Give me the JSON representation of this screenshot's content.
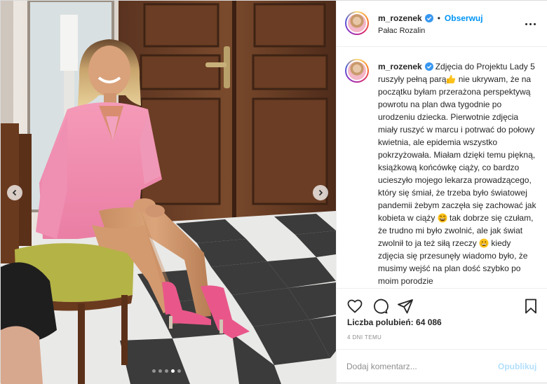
{
  "post": {
    "username": "m_rozenek",
    "follow_label": "Obserwuj",
    "location": "Pałac Rozalin",
    "caption_text": "Zdjęcia do Projektu Lady 5 ruszyły pełną parą",
    "caption_text_2": " nie ukrywam, że na początku byłam przerażona perspektywą powrotu na plan dwa tygodnie po urodzeniu dziecka. Pierwotnie zdjęcia miały ruszyć w marcu i potrwać do połowy kwietnia, ale epidemia wszystko pokrzyżowała. Miałam dzięki temu piękną, książkową końcówkę ciąży, co bardzo ucieszyło mojego lekarza prowadzącego, który się śmiał, że trzeba było światowej pandemii żebym zaczęła się zachować jak kobieta w ciąży",
    "caption_text_3": " tak dobrze się czułam, że trudno mi było zwolnić, ale jak świat zwolnił to ja też siłą rzeczy",
    "caption_text_4": " kiedy zdjęcia się przesunęły wiadomo było, że musimy wejść na plan dość szybko po moim porodzie",
    "likes_label": "Liczba polubień:",
    "likes_count": "64 086",
    "time": "4 DNI TEMU",
    "comment_placeholder": "Dodaj komentarz...",
    "publish_label": "Opublikuj",
    "carousel": {
      "total": 5,
      "active": 4
    }
  },
  "icons": {
    "verified": "verified-badge-icon",
    "like": "heart-icon",
    "comment": "comment-bubble-icon",
    "share": "paper-plane-icon",
    "save": "bookmark-icon",
    "more": "more-options-icon",
    "prev": "chevron-left-icon",
    "next": "chevron-right-icon",
    "emoji_1": "thumbs-up-emoji",
    "emoji_2": "laughing-emoji",
    "emoji_3": "grinning-emoji"
  },
  "colors": {
    "accent": "#0095f6",
    "publish_disabled": "#b2dffc",
    "text": "#262626",
    "muted": "#8e8e8e",
    "border": "#efefef"
  }
}
